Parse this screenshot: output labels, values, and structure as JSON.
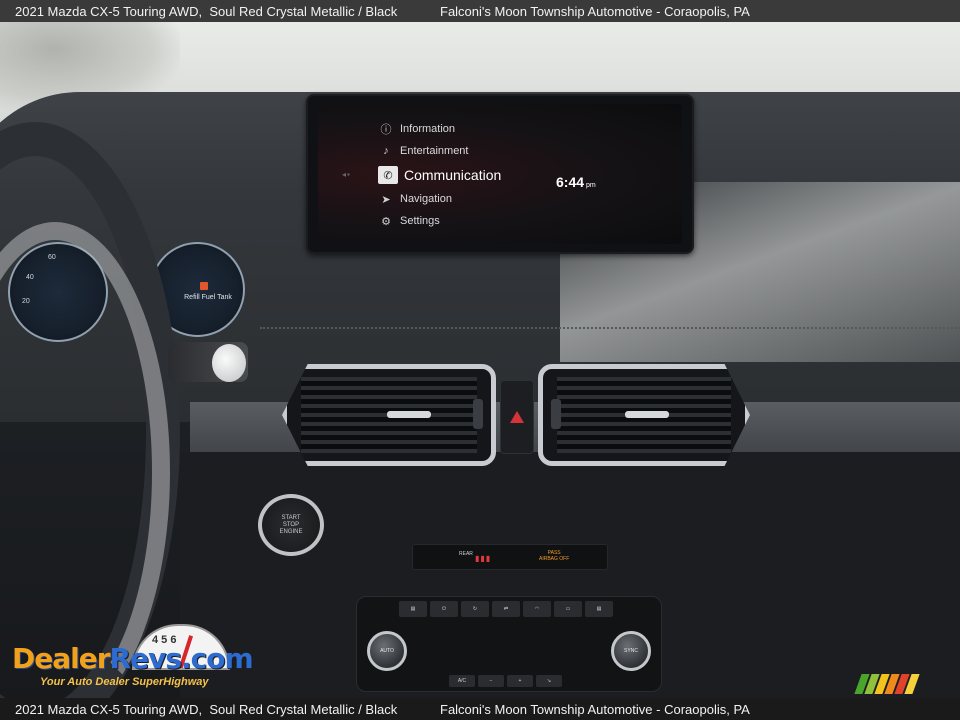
{
  "caption": {
    "left": "2021 Mazda CX-5 Touring AWD,  Soul Red Crystal Metallic / Black",
    "right": "Falconi's Moon Township Automotive - Coraopolis, PA"
  },
  "infotainment": {
    "menu": [
      {
        "icon": "info-icon",
        "glyph": "ⓘ",
        "label": "Information"
      },
      {
        "icon": "music-note-icon",
        "glyph": "♪",
        "label": "Entertainment"
      },
      {
        "icon": "phone-icon",
        "glyph": "✆",
        "label": "Communication",
        "active": true
      },
      {
        "icon": "navigation-arrow-icon",
        "glyph": "➤",
        "label": "Navigation"
      },
      {
        "icon": "gear-icon",
        "glyph": "⚙",
        "label": "Settings"
      }
    ],
    "time": "6:44",
    "ampm": "pm"
  },
  "cluster": {
    "speed_60": "60",
    "speed_40": "40",
    "speed_20": "20",
    "fuel_label": "Refill Fuel Tank"
  },
  "start_button": {
    "line1": "START",
    "line2": "STOP",
    "line3": "ENGINE"
  },
  "status_strip": {
    "rear": "REAR",
    "rear_icons": "▮▮▮",
    "pass_line1": "PASS",
    "pass_line2": "AIRBAG OFF"
  },
  "climate": {
    "top_buttons": [
      "",
      "",
      "",
      "",
      "",
      "",
      "",
      ""
    ],
    "left_knob": "AUTO",
    "right_knob": "SYNC",
    "bottom_buttons": [
      "A/C",
      "",
      "",
      ""
    ]
  },
  "watermark": {
    "brand_part1": "Dealer",
    "brand_part2": "Revs",
    "brand_suffix": ".com",
    "tagline": "Your Auto Dealer SuperHighway",
    "gauge_numbers": "4 5 6"
  },
  "colors": {
    "stripes": [
      "#4aa52b",
      "#8fc23a",
      "#f3c31b",
      "#f08a1d",
      "#e0432a",
      "#f5d23a"
    ]
  }
}
